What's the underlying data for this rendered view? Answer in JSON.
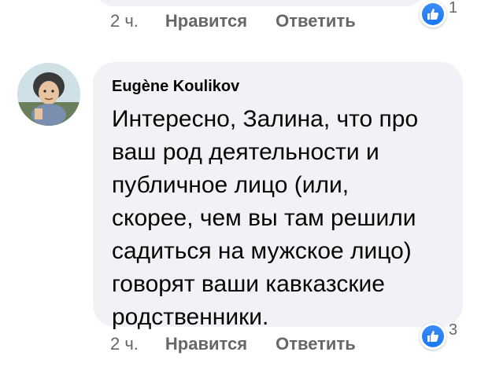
{
  "previous_comment": {
    "time": "2 ч.",
    "like_label": "Нравится",
    "reply_label": "Ответить",
    "reaction_count": "1",
    "reaction_icon": "thumbs-up-icon"
  },
  "comment": {
    "author": "Eugène Koulikov",
    "text": "Интересно, Залина, что про\nваш род деятельности и\nпубличное лицо (или,\nскорее, чем вы там решили\nсадиться на мужское лицо)\nговорят ваши кавказские\nродственники.",
    "time": "2 ч.",
    "like_label": "Нравится",
    "reply_label": "Ответить",
    "reaction_count": "3",
    "reaction_icon": "thumbs-up-icon"
  },
  "colors": {
    "bubble_bg": "#f0f2f5",
    "secondary_text": "#65676b",
    "primary_text": "#050505",
    "like_blue": "#1877f2"
  }
}
